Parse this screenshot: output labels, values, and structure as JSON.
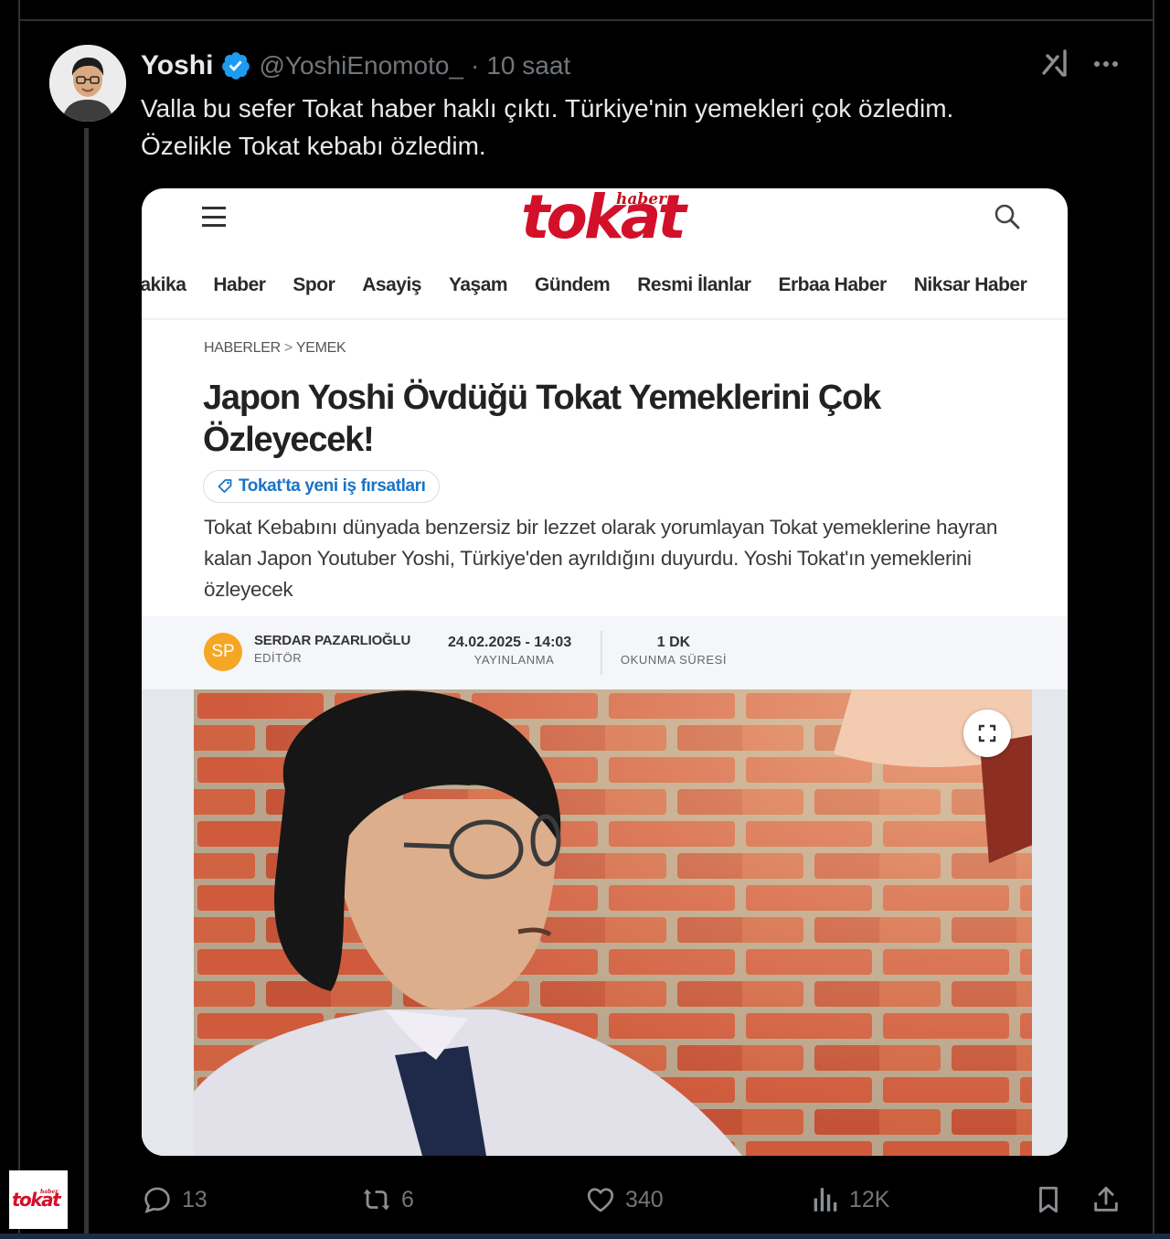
{
  "tweet": {
    "author_name": "Yoshi",
    "handle": "@YoshiEnomoto_",
    "separator": "·",
    "time": "10 saat",
    "text_line1": "Valla bu sefer Tokat haber haklı çıktı. Türkiye'nin yemekleri çok özledim.",
    "text_line2": "Özelikle Tokat kebabı özledim."
  },
  "actions": {
    "replies": "13",
    "reposts": "6",
    "likes": "340",
    "views": "12K"
  },
  "article": {
    "logo_small": "haber",
    "logo_main": "tokat",
    "nav": [
      "dakika",
      "Haber",
      "Spor",
      "Asayiş",
      "Yaşam",
      "Gündem",
      "Resmi İlanlar",
      "Erbaa Haber",
      "Niksar Haber"
    ],
    "breadcrumb": {
      "root": "HABERLER",
      "sep": ">",
      "section": "YEMEK"
    },
    "headline_line1": "Japon Yoshi Övdüğü Tokat Yemeklerini Çok",
    "headline_line2": "Özleyecek!",
    "tag": "Tokat'ta yeni iş fırsatları",
    "summary": "Tokat Kebabını dünyada benzersiz bir lezzet olarak yorumlayan Tokat yemeklerine hayran kalan Japon Youtuber Yoshi, Türkiye'den ayrıldığını duyurdu. Yoshi Tokat'ın yemeklerini özleyecek",
    "editor_initials": "SP",
    "editor_name": "SERDAR PAZARLIOĞLU",
    "editor_role": "EDİTÖR",
    "published": "24.02.2025 - 14:03",
    "published_label": "YAYINLANMA",
    "read_time": "1 DK",
    "read_time_label": "OKUNMA SÜRESİ"
  },
  "watermark": {
    "small": "haber",
    "main": "tokat"
  },
  "colors": {
    "background": "#000000",
    "text_primary": "#e7e9ea",
    "text_secondary": "#71767b",
    "verified_blue": "#1d9bf0",
    "brand_red": "#d3102a",
    "link_blue": "#1a73c6",
    "editor_orange": "#f5a623"
  },
  "icons": [
    "verified-badge-icon",
    "grok-icon",
    "more-icon",
    "hamburger-icon",
    "search-icon",
    "tag-icon",
    "expand-icon",
    "reply-icon",
    "repost-icon",
    "like-icon",
    "views-icon",
    "bookmark-icon",
    "share-icon"
  ]
}
